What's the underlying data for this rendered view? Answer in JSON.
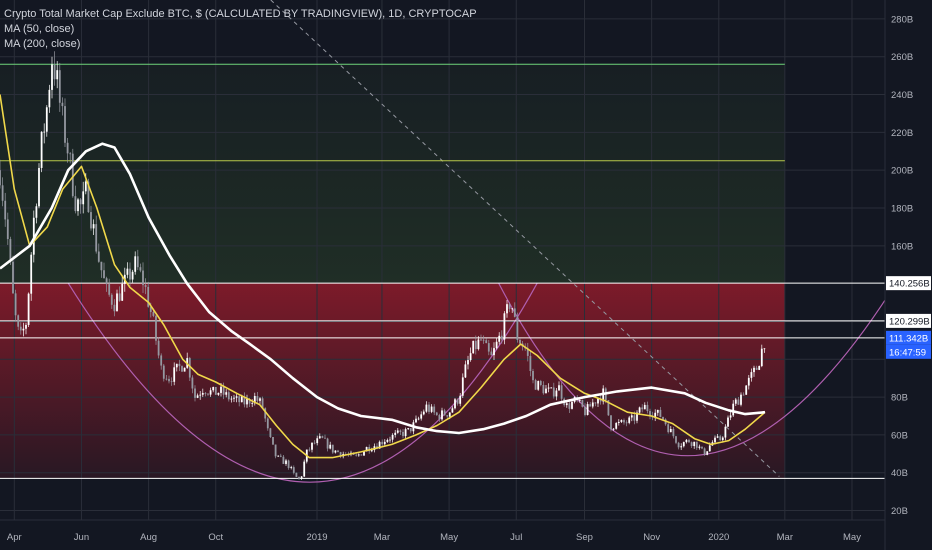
{
  "legend": {
    "title": "Crypto Total Market Cap Exclude BTC, $ (CALCULATED BY TRADINGVIEW), 1D, CRYPTOCAP",
    "ma1": "MA (50, close)",
    "ma2": "MA (200, close)"
  },
  "colors": {
    "background": "#131722",
    "grid": "#2a2e39",
    "axis_text": "#b2b5be",
    "ma50": "#f0d84a",
    "ma200": "#ffffff",
    "candle_up": "#ffffff",
    "candle_down": "#9598a1",
    "zone_red": "#a01c2c",
    "zone_green": "#2f4a2a",
    "cup_arc": "#b05fb0",
    "trendline": "#9598a1",
    "level_green": "#6fd37a",
    "level_yellow": "#b8c84a"
  },
  "price_labels": {
    "resistance": "140.256B",
    "mid_level": "120.299B",
    "last_price": "111.342B",
    "countdown": "16:47:59"
  },
  "chart_data": {
    "type": "line",
    "title": "Crypto Total Market Cap Exclude BTC, $ (CALCULATED BY TRADINGVIEW), 1D, CRYPTOCAP",
    "y_unit": "USD billions",
    "ylim": [
      15,
      290
    ],
    "xlim": [
      "2018-03-19",
      "2020-05-31"
    ],
    "x_ticks": [
      {
        "date": "2018-04-01",
        "label": "Apr"
      },
      {
        "date": "2018-06-01",
        "label": "Jun"
      },
      {
        "date": "2018-08-01",
        "label": "Aug"
      },
      {
        "date": "2018-10-01",
        "label": "Oct"
      },
      {
        "date": "2019-01-01",
        "label": "2019"
      },
      {
        "date": "2019-03-01",
        "label": "Mar"
      },
      {
        "date": "2019-05-01",
        "label": "May"
      },
      {
        "date": "2019-07-01",
        "label": "Jul"
      },
      {
        "date": "2019-09-01",
        "label": "Sep"
      },
      {
        "date": "2019-11-01",
        "label": "Nov"
      },
      {
        "date": "2020-01-01",
        "label": "2020"
      },
      {
        "date": "2020-03-01",
        "label": "Mar"
      },
      {
        "date": "2020-05-01",
        "label": "May"
      }
    ],
    "y_ticks": [
      {
        "value": 280,
        "label": "280B"
      },
      {
        "value": 260,
        "label": "260B"
      },
      {
        "value": 240,
        "label": "240B"
      },
      {
        "value": 220,
        "label": "220B"
      },
      {
        "value": 200,
        "label": "200B"
      },
      {
        "value": 180,
        "label": "180B"
      },
      {
        "value": 160,
        "label": "160B"
      },
      {
        "value": 80,
        "label": "80B"
      },
      {
        "value": 60,
        "label": "60B"
      },
      {
        "value": 40,
        "label": "40B"
      },
      {
        "value": 20,
        "label": "20B"
      }
    ],
    "price_series": [
      [
        "2018-03-19",
        200
      ],
      [
        "2018-03-25",
        170
      ],
      [
        "2018-04-01",
        125
      ],
      [
        "2018-04-06",
        110
      ],
      [
        "2018-04-12",
        120
      ],
      [
        "2018-04-18",
        170
      ],
      [
        "2018-04-25",
        210
      ],
      [
        "2018-05-01",
        235
      ],
      [
        "2018-05-05",
        260
      ],
      [
        "2018-05-09",
        250
      ],
      [
        "2018-05-14",
        228
      ],
      [
        "2018-05-20",
        210
      ],
      [
        "2018-05-26",
        185
      ],
      [
        "2018-06-01",
        180
      ],
      [
        "2018-06-06",
        190
      ],
      [
        "2018-06-10",
        175
      ],
      [
        "2018-06-16",
        155
      ],
      [
        "2018-06-24",
        135
      ],
      [
        "2018-07-01",
        130
      ],
      [
        "2018-07-10",
        140
      ],
      [
        "2018-07-20",
        150
      ],
      [
        "2018-07-28",
        140
      ],
      [
        "2018-08-05",
        120
      ],
      [
        "2018-08-12",
        95
      ],
      [
        "2018-08-20",
        90
      ],
      [
        "2018-08-28",
        95
      ],
      [
        "2018-09-05",
        100
      ],
      [
        "2018-09-12",
        80
      ],
      [
        "2018-09-20",
        85
      ],
      [
        "2018-09-28",
        82
      ],
      [
        "2018-10-05",
        83
      ],
      [
        "2018-10-12",
        80
      ],
      [
        "2018-10-20",
        78
      ],
      [
        "2018-10-28",
        77
      ],
      [
        "2018-11-05",
        80
      ],
      [
        "2018-11-12",
        76
      ],
      [
        "2018-11-18",
        60
      ],
      [
        "2018-11-25",
        48
      ],
      [
        "2018-12-05",
        45
      ],
      [
        "2018-12-12",
        38
      ],
      [
        "2018-12-17",
        36
      ],
      [
        "2018-12-22",
        50
      ],
      [
        "2018-12-28",
        55
      ],
      [
        "2019-01-05",
        58
      ],
      [
        "2019-01-15",
        52
      ],
      [
        "2019-01-25",
        50
      ],
      [
        "2019-02-05",
        48
      ],
      [
        "2019-02-15",
        53
      ],
      [
        "2019-02-25",
        55
      ],
      [
        "2019-03-05",
        58
      ],
      [
        "2019-03-15",
        60
      ],
      [
        "2019-03-25",
        62
      ],
      [
        "2019-04-03",
        68
      ],
      [
        "2019-04-10",
        75
      ],
      [
        "2019-04-20",
        70
      ],
      [
        "2019-05-01",
        72
      ],
      [
        "2019-05-10",
        80
      ],
      [
        "2019-05-16",
        95
      ],
      [
        "2019-05-22",
        105
      ],
      [
        "2019-05-30",
        110
      ],
      [
        "2019-06-08",
        100
      ],
      [
        "2019-06-18",
        115
      ],
      [
        "2019-06-26",
        132
      ],
      [
        "2019-07-02",
        112
      ],
      [
        "2019-07-10",
        105
      ],
      [
        "2019-07-16",
        88
      ],
      [
        "2019-07-24",
        85
      ],
      [
        "2019-08-02",
        82
      ],
      [
        "2019-08-08",
        86
      ],
      [
        "2019-08-16",
        75
      ],
      [
        "2019-08-24",
        78
      ],
      [
        "2019-09-02",
        72
      ],
      [
        "2019-09-10",
        78
      ],
      [
        "2019-09-18",
        82
      ],
      [
        "2019-09-25",
        65
      ],
      [
        "2019-10-05",
        66
      ],
      [
        "2019-10-15",
        68
      ],
      [
        "2019-10-25",
        75
      ],
      [
        "2019-11-02",
        72
      ],
      [
        "2019-11-10",
        70
      ],
      [
        "2019-11-18",
        62
      ],
      [
        "2019-11-26",
        55
      ],
      [
        "2019-12-05",
        57
      ],
      [
        "2019-12-12",
        55
      ],
      [
        "2019-12-18",
        50
      ],
      [
        "2019-12-26",
        56
      ],
      [
        "2020-01-03",
        58
      ],
      [
        "2020-01-08",
        65
      ],
      [
        "2020-01-14",
        75
      ],
      [
        "2020-01-20",
        80
      ],
      [
        "2020-01-28",
        88
      ],
      [
        "2020-02-05",
        96
      ],
      [
        "2020-02-12",
        111.342
      ]
    ],
    "series": [
      {
        "name": "MA (50, close)",
        "points": [
          [
            "2018-03-19",
            240
          ],
          [
            "2018-04-01",
            190
          ],
          [
            "2018-04-15",
            160
          ],
          [
            "2018-05-01",
            170
          ],
          [
            "2018-05-15",
            190
          ],
          [
            "2018-06-01",
            202
          ],
          [
            "2018-06-15",
            180
          ],
          [
            "2018-07-01",
            150
          ],
          [
            "2018-07-15",
            138
          ],
          [
            "2018-08-01",
            130
          ],
          [
            "2018-08-15",
            118
          ],
          [
            "2018-09-01",
            100
          ],
          [
            "2018-09-15",
            92
          ],
          [
            "2018-10-01",
            88
          ],
          [
            "2018-10-20",
            82
          ],
          [
            "2018-11-10",
            76
          ],
          [
            "2018-11-25",
            65
          ],
          [
            "2018-12-10",
            55
          ],
          [
            "2018-12-25",
            48
          ],
          [
            "2019-01-15",
            48
          ],
          [
            "2019-02-10",
            51
          ],
          [
            "2019-03-10",
            55
          ],
          [
            "2019-04-01",
            60
          ],
          [
            "2019-04-20",
            65
          ],
          [
            "2019-05-10",
            72
          ],
          [
            "2019-05-30",
            85
          ],
          [
            "2019-06-20",
            100
          ],
          [
            "2019-07-05",
            108
          ],
          [
            "2019-07-20",
            102
          ],
          [
            "2019-08-10",
            90
          ],
          [
            "2019-09-01",
            82
          ],
          [
            "2019-09-20",
            78
          ],
          [
            "2019-10-10",
            72
          ],
          [
            "2019-11-01",
            70
          ],
          [
            "2019-11-20",
            66
          ],
          [
            "2019-12-10",
            58
          ],
          [
            "2019-12-25",
            55
          ],
          [
            "2020-01-10",
            57
          ],
          [
            "2020-01-25",
            63
          ],
          [
            "2020-02-12",
            72
          ]
        ]
      },
      {
        "name": "MA (200, close)",
        "points": [
          [
            "2018-03-19",
            148
          ],
          [
            "2018-04-15",
            160
          ],
          [
            "2018-05-05",
            180
          ],
          [
            "2018-05-20",
            200
          ],
          [
            "2018-06-05",
            210
          ],
          [
            "2018-06-20",
            214
          ],
          [
            "2018-07-01",
            212
          ],
          [
            "2018-07-15",
            198
          ],
          [
            "2018-08-01",
            175
          ],
          [
            "2018-08-20",
            155
          ],
          [
            "2018-09-05",
            140
          ],
          [
            "2018-09-25",
            125
          ],
          [
            "2018-10-15",
            115
          ],
          [
            "2018-11-01",
            108
          ],
          [
            "2018-11-20",
            100
          ],
          [
            "2018-12-10",
            90
          ],
          [
            "2019-01-01",
            80
          ],
          [
            "2019-01-20",
            74
          ],
          [
            "2019-02-10",
            70
          ],
          [
            "2019-03-10",
            68
          ],
          [
            "2019-04-01",
            64
          ],
          [
            "2019-04-20",
            62
          ],
          [
            "2019-05-10",
            61
          ],
          [
            "2019-06-01",
            63
          ],
          [
            "2019-06-20",
            66
          ],
          [
            "2019-07-10",
            70
          ],
          [
            "2019-08-01",
            76
          ],
          [
            "2019-09-01",
            80
          ],
          [
            "2019-10-01",
            83
          ],
          [
            "2019-11-01",
            85
          ],
          [
            "2019-12-01",
            82
          ],
          [
            "2019-12-20",
            77
          ],
          [
            "2020-01-10",
            73
          ],
          [
            "2020-01-25",
            71
          ],
          [
            "2020-02-12",
            72
          ]
        ]
      }
    ],
    "horizontal_levels": [
      {
        "value": 256,
        "style": "level_green"
      },
      {
        "value": 205,
        "style": "level_yellow"
      },
      {
        "value": 140.256,
        "style": "white"
      },
      {
        "value": 120.299,
        "style": "white"
      },
      {
        "value": 111.342,
        "style": "white"
      },
      {
        "value": 37,
        "style": "white"
      }
    ],
    "zones": [
      {
        "from": 140.256,
        "to": 256,
        "style": "zone_green",
        "x_end": "2020-03-01"
      },
      {
        "from": 37,
        "to": 140.256,
        "style": "zone_red",
        "x_end": "2020-03-01"
      }
    ],
    "cup_arcs": [
      {
        "start": [
          "2018-05-20",
          140.256
        ],
        "bottom": [
          "2019-01-01",
          35
        ],
        "end": [
          "2019-07-20",
          140.256
        ]
      },
      {
        "start": [
          "2019-06-15",
          140.256
        ],
        "bottom": [
          "2019-11-25",
          49
        ],
        "end": [
          "2020-06-10",
          140.256
        ]
      }
    ],
    "trendline": {
      "start": [
        "2018-11-20",
        290
      ],
      "end": [
        "2020-02-25",
        38
      ]
    },
    "grid": true,
    "legend_position": "top-left"
  }
}
